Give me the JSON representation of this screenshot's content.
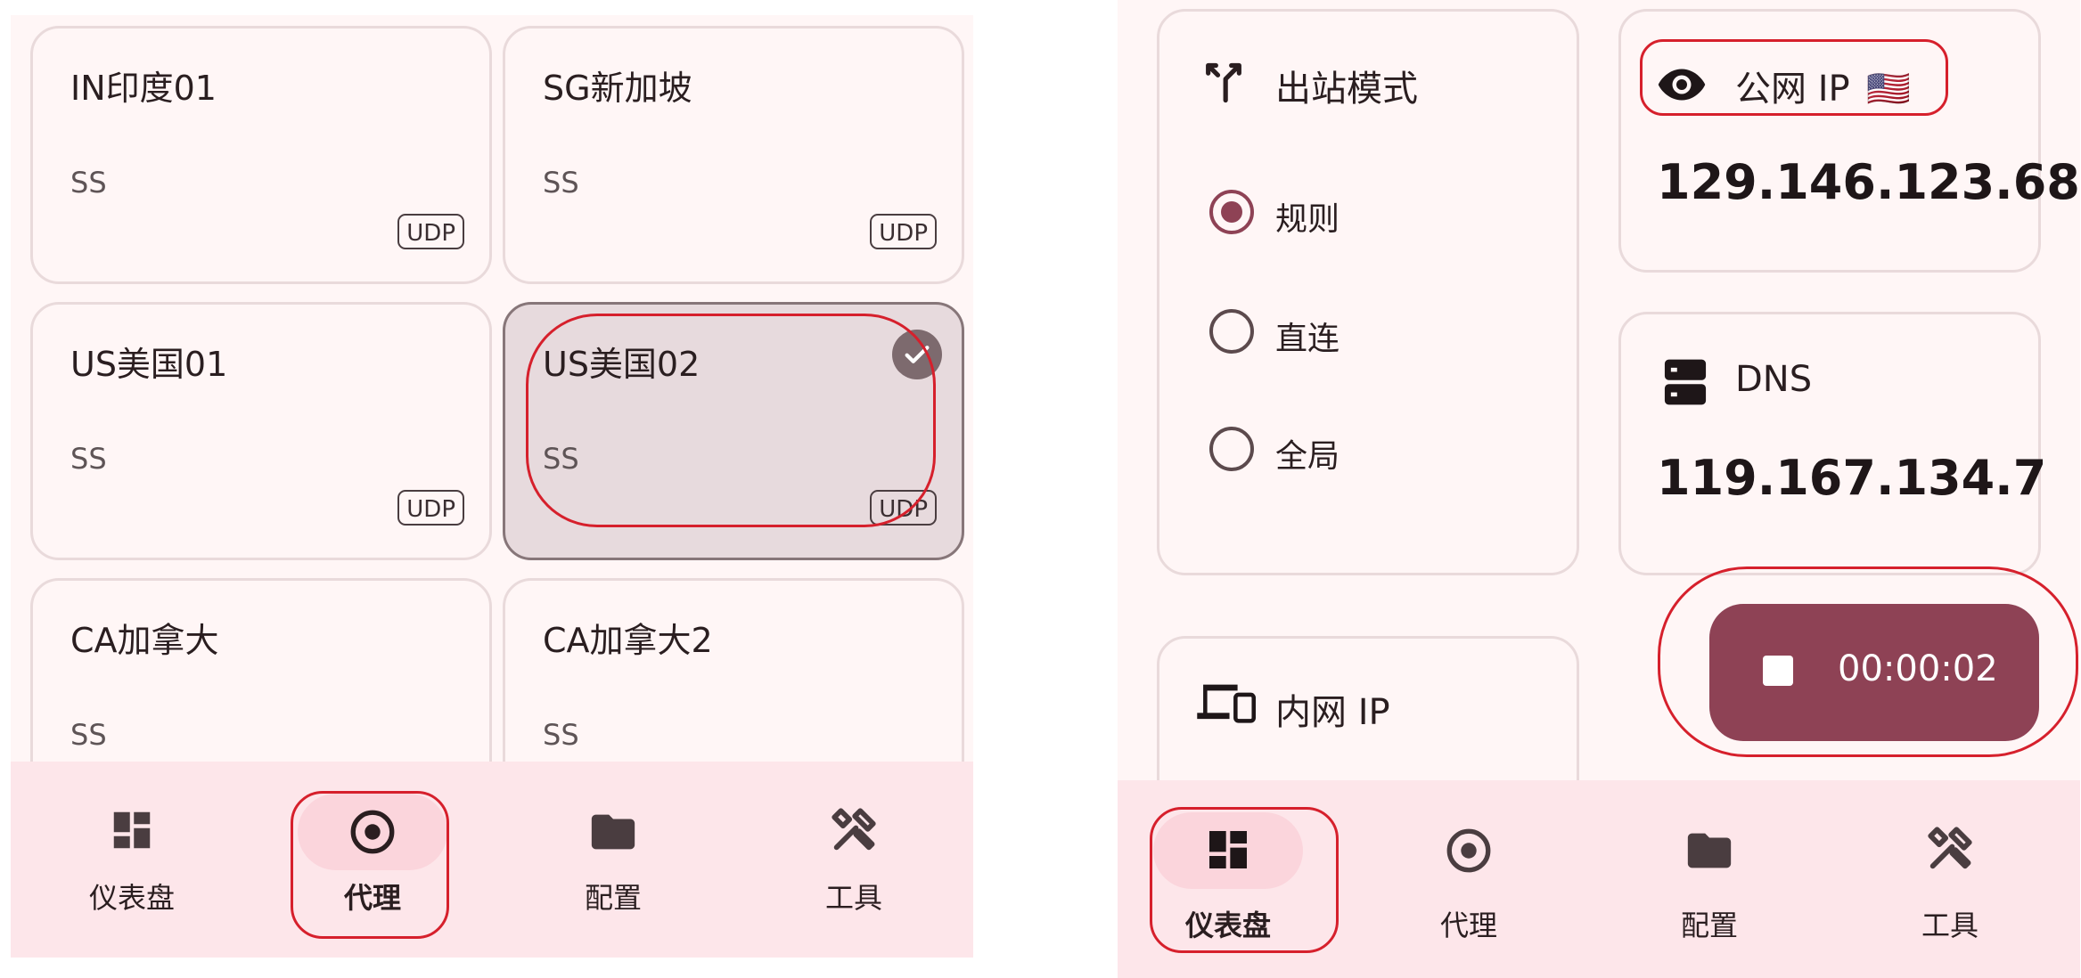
{
  "left": {
    "proxies": [
      {
        "name": "IN印度01",
        "type": "SS",
        "badge": "UDP",
        "selected": false
      },
      {
        "name": "SG新加坡",
        "type": "SS",
        "badge": "UDP",
        "selected": false
      },
      {
        "name": "US美国01",
        "type": "SS",
        "badge": "UDP",
        "selected": false
      },
      {
        "name": "US美国02",
        "type": "SS",
        "badge": "UDP",
        "selected": true
      },
      {
        "name": "CA加拿大",
        "type": "SS",
        "badge": "",
        "selected": false
      },
      {
        "name": "CA加拿大2",
        "type": "SS",
        "badge": "",
        "selected": false
      }
    ],
    "nav": [
      {
        "label": "仪表盘",
        "icon": "dashboard-icon",
        "active": false
      },
      {
        "label": "代理",
        "icon": "proxy-target-icon",
        "active": true
      },
      {
        "label": "配置",
        "icon": "folder-icon",
        "active": false
      },
      {
        "label": "工具",
        "icon": "tools-icon",
        "active": false
      }
    ]
  },
  "right": {
    "outbound": {
      "title": "出站模式",
      "icon": "fork-arrows-icon",
      "options": [
        {
          "label": "规则",
          "checked": true
        },
        {
          "label": "直连",
          "checked": false
        },
        {
          "label": "全局",
          "checked": false
        }
      ]
    },
    "public_ip": {
      "title": "公网 IP",
      "flag": "🇺🇸",
      "icon": "eye-icon",
      "value": "129.146.123.68"
    },
    "dns": {
      "title": "DNS",
      "icon": "dns-server-icon",
      "value": "119.167.134.7"
    },
    "lan_ip": {
      "title": "内网 IP",
      "icon": "devices-icon"
    },
    "timer": {
      "value": "00:00:02",
      "icon": "stop-icon"
    },
    "nav": [
      {
        "label": "仪表盘",
        "icon": "dashboard-icon",
        "active": true
      },
      {
        "label": "代理",
        "icon": "proxy-target-icon",
        "active": false
      },
      {
        "label": "配置",
        "icon": "folder-icon",
        "active": false
      },
      {
        "label": "工具",
        "icon": "tools-icon",
        "active": false
      }
    ]
  },
  "colors": {
    "accent": "#8e4255",
    "nav_bg": "#fde6ea",
    "panel_bg": "#fff6f6",
    "annotation": "#d6202c"
  }
}
